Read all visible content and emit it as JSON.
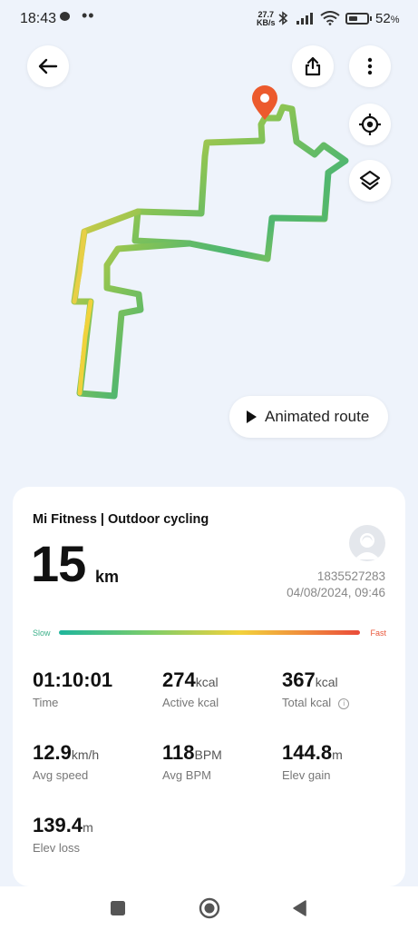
{
  "status_bar": {
    "time": "18:43",
    "dots": "••",
    "net_speed_value": "27.7",
    "net_speed_unit": "KB/s",
    "battery_percent_label": "52",
    "battery_percent_sign": "%",
    "battery_level": 0.52
  },
  "map": {
    "back_icon": "arrow-left-icon",
    "share_icon": "share-icon",
    "more_icon": "more-vertical-icon",
    "locate_icon": "locate-icon",
    "layers_icon": "layers-icon",
    "end_marker_icon": "map-pin-icon",
    "animated_route_label": "Animated route",
    "route_colors": [
      "#2fb48a",
      "#9cc84a",
      "#e9d13e",
      "#6fbd55"
    ]
  },
  "workout": {
    "title": "Mi Fitness | Outdoor cycling",
    "distance_value": "15",
    "distance_unit": "km",
    "user_id": "1835527283",
    "datetime": "04/08/2024, 09:46",
    "speed_scale": {
      "slow_label": "Slow",
      "fast_label": "Fast"
    },
    "metrics": [
      {
        "value": "01:10:01",
        "unit": "",
        "label": "Time"
      },
      {
        "value": "274",
        "unit": "kcal",
        "label": "Active kcal"
      },
      {
        "value": "367",
        "unit": "kcal",
        "label": "Total kcal"
      },
      {
        "value": "12.9",
        "unit": "km/h",
        "label": "Avg speed"
      },
      {
        "value": "118",
        "unit": "BPM",
        "label": "Avg BPM"
      },
      {
        "value": "144.8",
        "unit": "m",
        "label": "Elev gain"
      },
      {
        "value": "139.4",
        "unit": "m",
        "label": "Elev loss"
      }
    ],
    "info_icon": "info-icon"
  },
  "nav_bar": {
    "recents_icon": "square-recents-icon",
    "home_icon": "circle-home-icon",
    "back_icon": "triangle-back-icon"
  }
}
